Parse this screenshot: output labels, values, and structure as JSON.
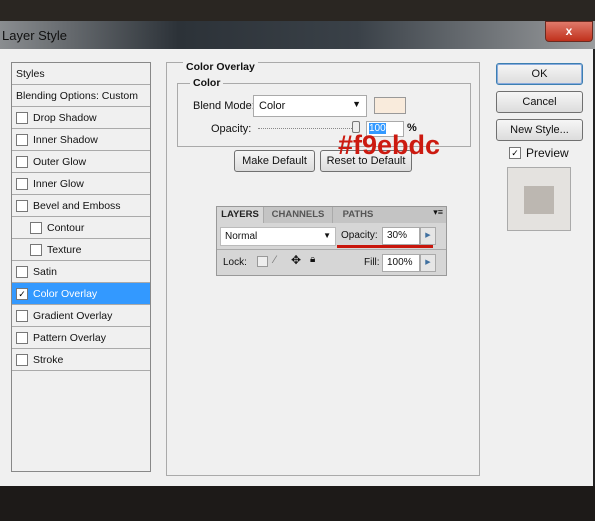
{
  "window": {
    "title": "Layer Style",
    "close_label": "x"
  },
  "sidebar": {
    "items": [
      {
        "label": "Styles",
        "checkbox": false
      },
      {
        "label": "Blending Options: Custom",
        "checkbox": false
      },
      {
        "label": "Drop Shadow",
        "checkbox": true,
        "checked": false
      },
      {
        "label": "Inner Shadow",
        "checkbox": true,
        "checked": false
      },
      {
        "label": "Outer Glow",
        "checkbox": true,
        "checked": false
      },
      {
        "label": "Inner Glow",
        "checkbox": true,
        "checked": false
      },
      {
        "label": "Bevel and Emboss",
        "checkbox": true,
        "checked": false
      },
      {
        "label": "Contour",
        "checkbox": true,
        "checked": false,
        "indent": true
      },
      {
        "label": "Texture",
        "checkbox": true,
        "checked": false,
        "indent": true
      },
      {
        "label": "Satin",
        "checkbox": true,
        "checked": false
      },
      {
        "label": "Color Overlay",
        "checkbox": true,
        "checked": true,
        "selected": true
      },
      {
        "label": "Gradient Overlay",
        "checkbox": true,
        "checked": false
      },
      {
        "label": "Pattern Overlay",
        "checkbox": true,
        "checked": false
      },
      {
        "label": "Stroke",
        "checkbox": true,
        "checked": false
      }
    ]
  },
  "overlay": {
    "section": "Color Overlay",
    "group": "Color",
    "blend_label": "Blend Mode:",
    "blend_value": "Color",
    "swatch_color": "#f9ebdc",
    "opacity_label": "Opacity:",
    "opacity_value": "100",
    "opacity_unit": "%",
    "make_default": "Make Default",
    "reset_default": "Reset to Default"
  },
  "annotation": {
    "hex": "#f9ebdc",
    "color": "#cc1a10"
  },
  "layers_panel": {
    "tabs": [
      "LAYERS",
      "CHANNELS",
      "PATHS"
    ],
    "blend": "Normal",
    "opacity_label": "Opacity:",
    "opacity": "30%",
    "lock_label": "Lock:",
    "fill_label": "Fill:",
    "fill": "100%"
  },
  "buttons": {
    "ok": "OK",
    "cancel": "Cancel",
    "new_style": "New Style...",
    "preview": "Preview",
    "preview_checked": true
  }
}
